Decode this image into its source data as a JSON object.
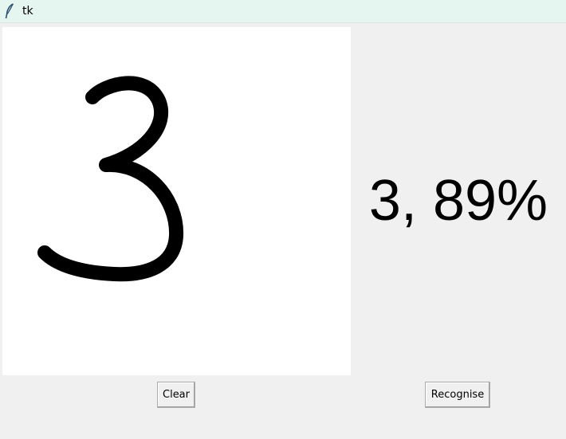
{
  "window": {
    "title": "tk",
    "icon": "feather-icon"
  },
  "canvas": {
    "background": "#ffffff",
    "stroke_color": "#000000",
    "drawn_digit": "3"
  },
  "result": {
    "text": "3, 89%"
  },
  "buttons": {
    "clear_label": "Clear",
    "recognise_label": "Recognise"
  }
}
